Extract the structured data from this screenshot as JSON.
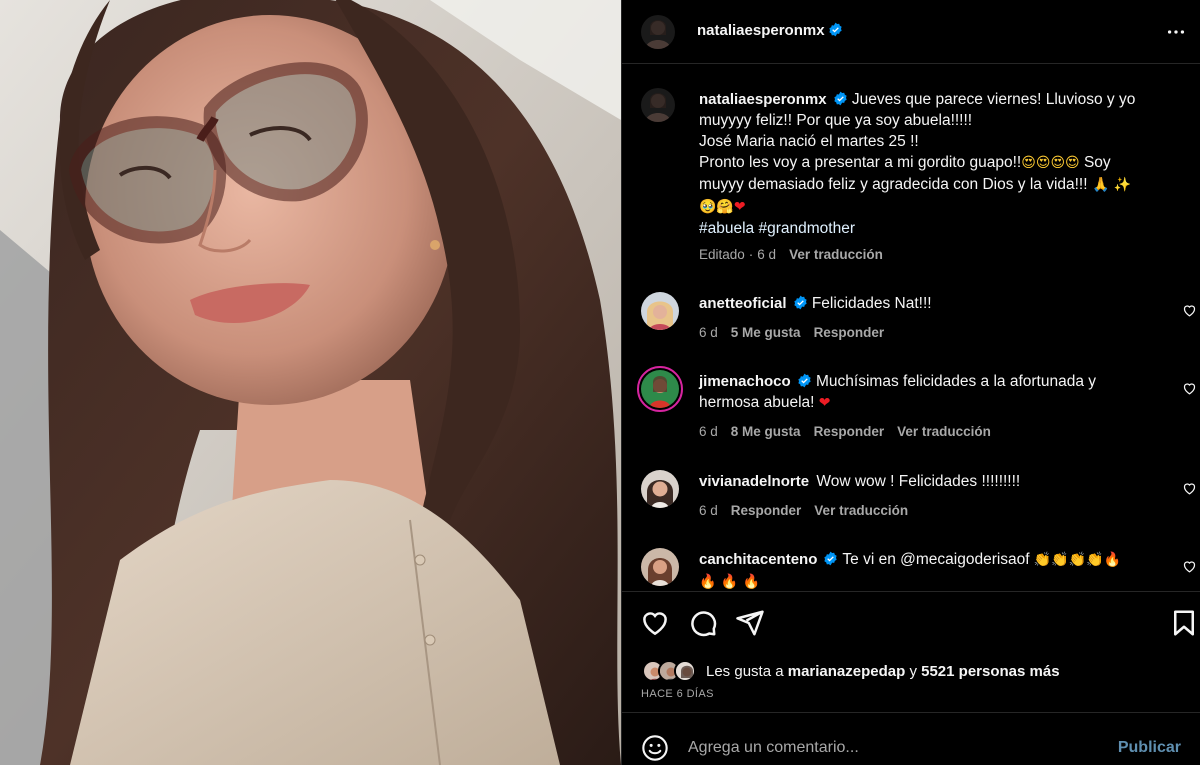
{
  "post": {
    "author": "nataliaesperonmx",
    "caption_lines": [
      "Jueves que parece viernes! Lluvioso y yo",
      "muyyyy feliz!! Por que ya soy abuela!!!!!",
      "José Maria nació el martes 25 !!",
      "Pronto les voy a presentar a mi gordito guapo!!",
      "Soy",
      "muyyy demasiado feliz y agradecida con Dios y la vida!!!"
    ],
    "hashtags": "#abuela #grandmother",
    "edited_label": "Editado",
    "age": "6 d",
    "translate_label": "Ver traducción"
  },
  "comments": [
    {
      "user": "anetteoficial",
      "text": "Felicidades Nat!!!",
      "age": "6 d",
      "likes": "5 Me gusta",
      "reply": "Responder",
      "translate": ""
    },
    {
      "user": "jimenachoco",
      "text_line1": "Muchísimas felicidades a la afortunada y",
      "text_line2": "hermosa abuela!",
      "age": "6 d",
      "likes": "8 Me gusta",
      "reply": "Responder",
      "translate": "Ver traducción"
    },
    {
      "user": "vivianadelnorte",
      "text": "Wow wow ! Felicidades !!!!!!!!!",
      "age": "6 d",
      "reply": "Responder",
      "translate": "Ver traducción"
    },
    {
      "user": "canchitacenteno",
      "text": "Te vi en @mecaigoderisaof"
    }
  ],
  "likes_summary": {
    "prefix": "Les gusta a",
    "user": "marianazepedap",
    "connector": "y",
    "others": "5521 personas más"
  },
  "timestamp": "HACE 6 DÍAS",
  "add_comment": {
    "placeholder": "Agrega un comentario...",
    "publish_label": "Publicar"
  },
  "icons": {
    "verified": "verified-badge-icon",
    "more": "more-options-icon",
    "like": "heart-icon",
    "comment": "comment-bubble-icon",
    "share": "paper-plane-icon",
    "save": "bookmark-icon",
    "emoji": "emoji-smile-icon"
  },
  "colors": {
    "background": "#000000",
    "text": "#f5f5f5",
    "muted": "#a8a8a8",
    "verified": "#0095f6",
    "publish": "#5f8fb0",
    "heart_red": "#ed1c24"
  }
}
